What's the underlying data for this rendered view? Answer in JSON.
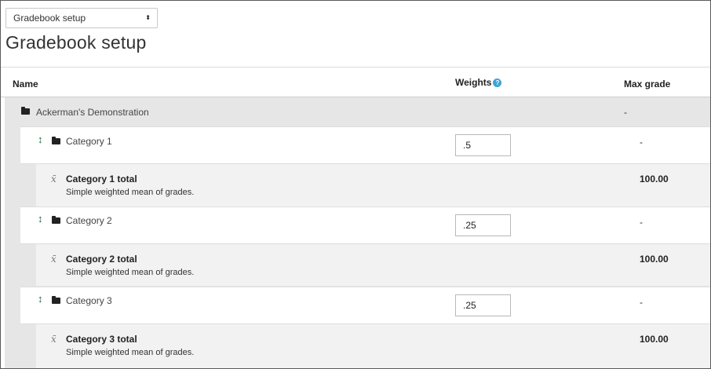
{
  "selector": {
    "value": "Gradebook setup",
    "arrows": "⬍"
  },
  "page_title": "Gradebook setup",
  "table": {
    "columns": {
      "name": "Name",
      "weights": "Weights",
      "max_grade": "Max grade"
    },
    "help_icon": "question-icon",
    "course": {
      "name": "Ackerman's Demonstration",
      "max": "-"
    },
    "categories": [
      {
        "name": "Category 1",
        "weight": ".5",
        "max": "-",
        "total_name": "Category 1 total",
        "total_desc": "Simple weighted mean of grades.",
        "total_max": "100.00"
      },
      {
        "name": "Category 2",
        "weight": ".25",
        "max": "-",
        "total_name": "Category 2 total",
        "total_desc": "Simple weighted mean of grades.",
        "total_max": "100.00"
      },
      {
        "name": "Category 3",
        "weight": ".25",
        "max": "-",
        "total_name": "Category 3 total",
        "total_desc": "Simple weighted mean of grades.",
        "total_max": "100.00"
      }
    ]
  },
  "colors": {
    "band": "#e6e6e6",
    "total_row": "#f2f2f2",
    "help": "#3fa3d8",
    "move": "#1b6b3b"
  }
}
